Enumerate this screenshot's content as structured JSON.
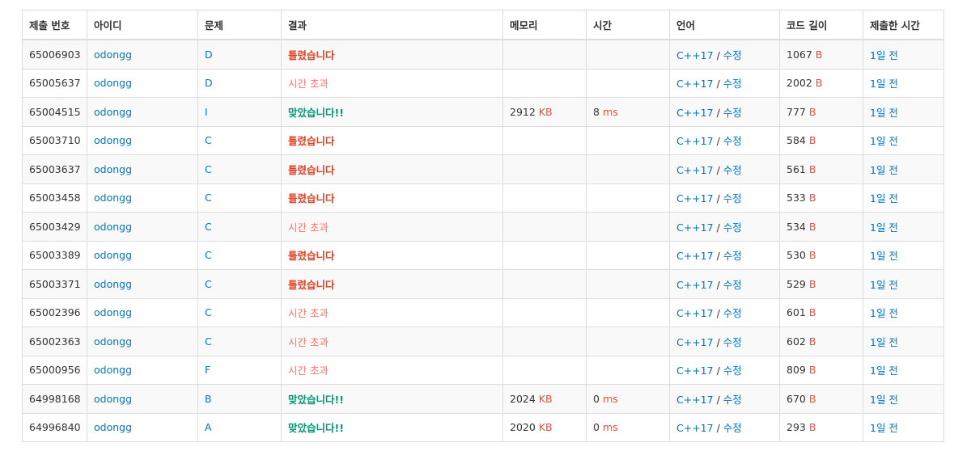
{
  "headers": [
    "제출 번호",
    "아이디",
    "문제",
    "결과",
    "메모리",
    "시간",
    "언어",
    "코드 길이",
    "제출한 시간"
  ],
  "rows": [
    {
      "id": "65006903",
      "user": "odongg",
      "problem": "D",
      "result": "틀렸습니다",
      "result_type": "wrong",
      "memory": "",
      "time": "",
      "lang": "C++17",
      "edit": "수정",
      "code_len": "1067",
      "submitted": "1일 전"
    },
    {
      "id": "65005637",
      "user": "odongg",
      "problem": "D",
      "result": "시간 초과",
      "result_type": "tle",
      "memory": "",
      "time": "",
      "lang": "C++17",
      "edit": "수정",
      "code_len": "2002",
      "submitted": "1일 전"
    },
    {
      "id": "65004515",
      "user": "odongg",
      "problem": "I",
      "result": "맞았습니다!!",
      "result_type": "ac",
      "memory": "2912",
      "time": "8",
      "lang": "C++17",
      "edit": "수정",
      "code_len": "777",
      "submitted": "1일 전"
    },
    {
      "id": "65003710",
      "user": "odongg",
      "problem": "C",
      "result": "틀렸습니다",
      "result_type": "wrong",
      "memory": "",
      "time": "",
      "lang": "C++17",
      "edit": "수정",
      "code_len": "584",
      "submitted": "1일 전"
    },
    {
      "id": "65003637",
      "user": "odongg",
      "problem": "C",
      "result": "틀렸습니다",
      "result_type": "wrong",
      "memory": "",
      "time": "",
      "lang": "C++17",
      "edit": "수정",
      "code_len": "561",
      "submitted": "1일 전"
    },
    {
      "id": "65003458",
      "user": "odongg",
      "problem": "C",
      "result": "틀렸습니다",
      "result_type": "wrong",
      "memory": "",
      "time": "",
      "lang": "C++17",
      "edit": "수정",
      "code_len": "533",
      "submitted": "1일 전"
    },
    {
      "id": "65003429",
      "user": "odongg",
      "problem": "C",
      "result": "시간 초과",
      "result_type": "tle",
      "memory": "",
      "time": "",
      "lang": "C++17",
      "edit": "수정",
      "code_len": "534",
      "submitted": "1일 전"
    },
    {
      "id": "65003389",
      "user": "odongg",
      "problem": "C",
      "result": "틀렸습니다",
      "result_type": "wrong",
      "memory": "",
      "time": "",
      "lang": "C++17",
      "edit": "수정",
      "code_len": "530",
      "submitted": "1일 전"
    },
    {
      "id": "65003371",
      "user": "odongg",
      "problem": "C",
      "result": "틀렸습니다",
      "result_type": "wrong",
      "memory": "",
      "time": "",
      "lang": "C++17",
      "edit": "수정",
      "code_len": "529",
      "submitted": "1일 전"
    },
    {
      "id": "65002396",
      "user": "odongg",
      "problem": "C",
      "result": "시간 초과",
      "result_type": "tle",
      "memory": "",
      "time": "",
      "lang": "C++17",
      "edit": "수정",
      "code_len": "601",
      "submitted": "1일 전"
    },
    {
      "id": "65002363",
      "user": "odongg",
      "problem": "C",
      "result": "시간 초과",
      "result_type": "tle",
      "memory": "",
      "time": "",
      "lang": "C++17",
      "edit": "수정",
      "code_len": "602",
      "submitted": "1일 전"
    },
    {
      "id": "65000956",
      "user": "odongg",
      "problem": "F",
      "result": "시간 초과",
      "result_type": "tle",
      "memory": "",
      "time": "",
      "lang": "C++17",
      "edit": "수정",
      "code_len": "809",
      "submitted": "1일 전"
    },
    {
      "id": "64998168",
      "user": "odongg",
      "problem": "B",
      "result": "맞았습니다!!",
      "result_type": "ac",
      "memory": "2024",
      "time": "0",
      "lang": "C++17",
      "edit": "수정",
      "code_len": "670",
      "submitted": "1일 전"
    },
    {
      "id": "64996840",
      "user": "odongg",
      "problem": "A",
      "result": "맞았습니다!!",
      "result_type": "ac",
      "memory": "2020",
      "time": "0",
      "lang": "C++17",
      "edit": "수정",
      "code_len": "293",
      "submitted": "1일 전"
    }
  ],
  "units": {
    "memory": "KB",
    "time": "ms",
    "code": "B"
  },
  "separator": "/",
  "colors": {
    "link": "#0076c0",
    "wrong": "#dd4124",
    "tle": "#fa7268",
    "ac": "#009874",
    "unit": "#e74c3c"
  }
}
